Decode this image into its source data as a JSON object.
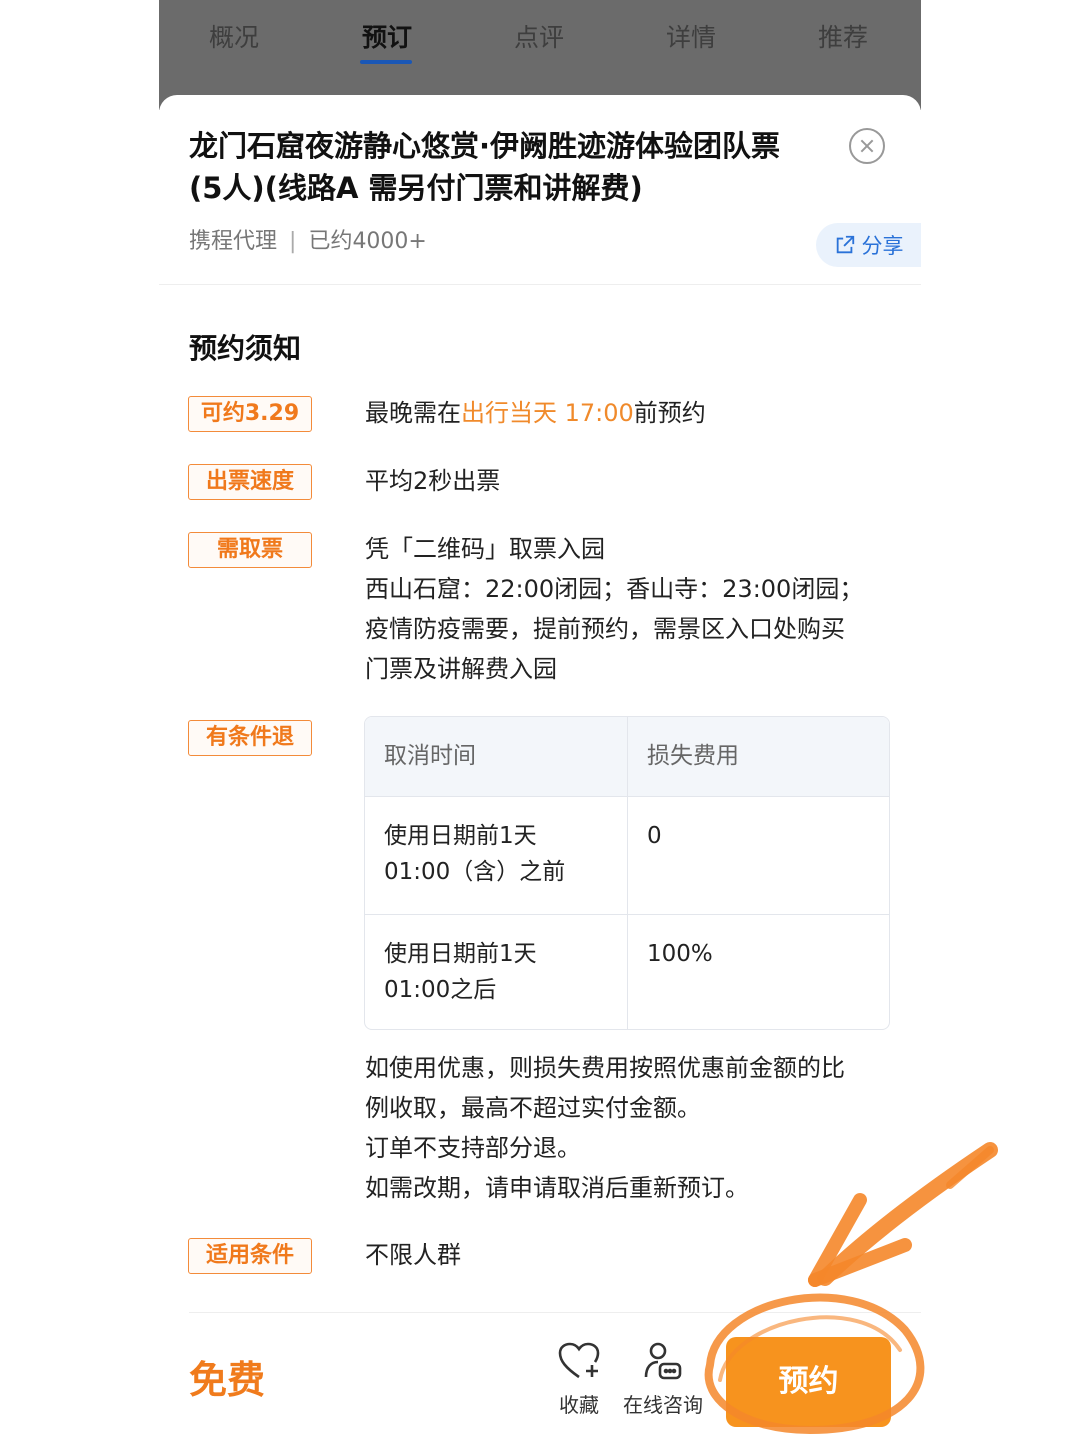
{
  "tabs": [
    {
      "label": "概况"
    },
    {
      "label": "预订"
    },
    {
      "label": "点评"
    },
    {
      "label": "详情"
    },
    {
      "label": "推荐"
    }
  ],
  "active_tab": "预订",
  "product": {
    "title_line1": "龙门石窟夜游静心悠赏·伊阙胜迹游体验团队票",
    "title_line2": "(5人)(线路A 需另付门票和讲解费)",
    "agent": "携程代理",
    "separator": "|",
    "booked": "已约4000+",
    "share_label": "分享"
  },
  "notice": {
    "title": "预约须知",
    "rows": [
      {
        "tag": "可约3.29",
        "text_before": "最晚需在",
        "text_highlight": "出行当天 17:00",
        "text_after": "前预约"
      },
      {
        "tag": "出票速度",
        "text": "平均2秒出票"
      },
      {
        "tag": "需取票",
        "lines": [
          "凭「二维码」取票入园",
          "西山石窟：22:00闭园；香山寺：23:00闭园；",
          "疫情防疫需要，提前预约，需景区入口处购买",
          "门票及讲解费入园"
        ]
      },
      {
        "tag": "有条件退"
      },
      {
        "tag": "适用条件",
        "text": "不限人群"
      }
    ],
    "refund_table": {
      "headers": [
        "取消时间",
        "损失费用"
      ],
      "rows": [
        {
          "time_line1": "使用日期前1天",
          "time_line2": "01:00（含）之前",
          "fee": "0"
        },
        {
          "time_line1": "使用日期前1天",
          "time_line2": "01:00之后",
          "fee": "100%"
        }
      ]
    },
    "refund_notes": [
      "如使用优惠，则损失费用按照优惠前金额的比",
      "例收取，最高不超过实付金额。",
      "订单不支持部分退。",
      "如需改期，请申请取消后重新预订。"
    ]
  },
  "bottom_bar": {
    "price": "免费",
    "favorite_label": "收藏",
    "consult_label": "在线咨询",
    "book_label": "预约"
  },
  "colors": {
    "accent_orange": "#f7931e",
    "tag_orange": "#f0791c",
    "link_blue": "#2a72d8",
    "annotation_orange": "#f5872a"
  }
}
